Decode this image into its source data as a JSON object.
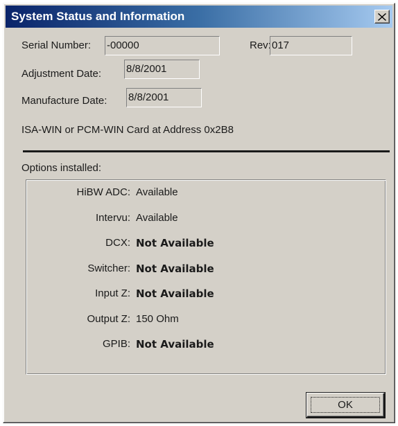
{
  "window": {
    "title": "System Status and Information",
    "close_icon": "close-icon"
  },
  "info": {
    "serial_label": "Serial Number:",
    "serial_value": "-00000",
    "rev_label": "Rev:",
    "rev_value": "017",
    "adjustment_label": "Adjustment Date:",
    "adjustment_value": "8/8/2001",
    "manufacture_label": "Manufacture Date:",
    "manufacture_value": "8/8/2001",
    "card_text": "ISA-WIN or PCM-WIN Card at Address 0x2B8"
  },
  "options": {
    "heading": "Options installed:",
    "items": [
      {
        "label": "HiBW ADC:",
        "value": "Available",
        "bold": false
      },
      {
        "label": "Intervu:",
        "value": "Available",
        "bold": false
      },
      {
        "label": "DCX:",
        "value": "Not Available",
        "bold": true
      },
      {
        "label": "Switcher:",
        "value": "Not Available",
        "bold": true
      },
      {
        "label": "Input Z:",
        "value": "Not Available",
        "bold": true
      },
      {
        "label": "Output Z:",
        "value": "150 Ohm",
        "bold": false
      },
      {
        "label": "GPIB:",
        "value": "Not Available",
        "bold": true
      }
    ]
  },
  "buttons": {
    "ok_label": "OK"
  }
}
